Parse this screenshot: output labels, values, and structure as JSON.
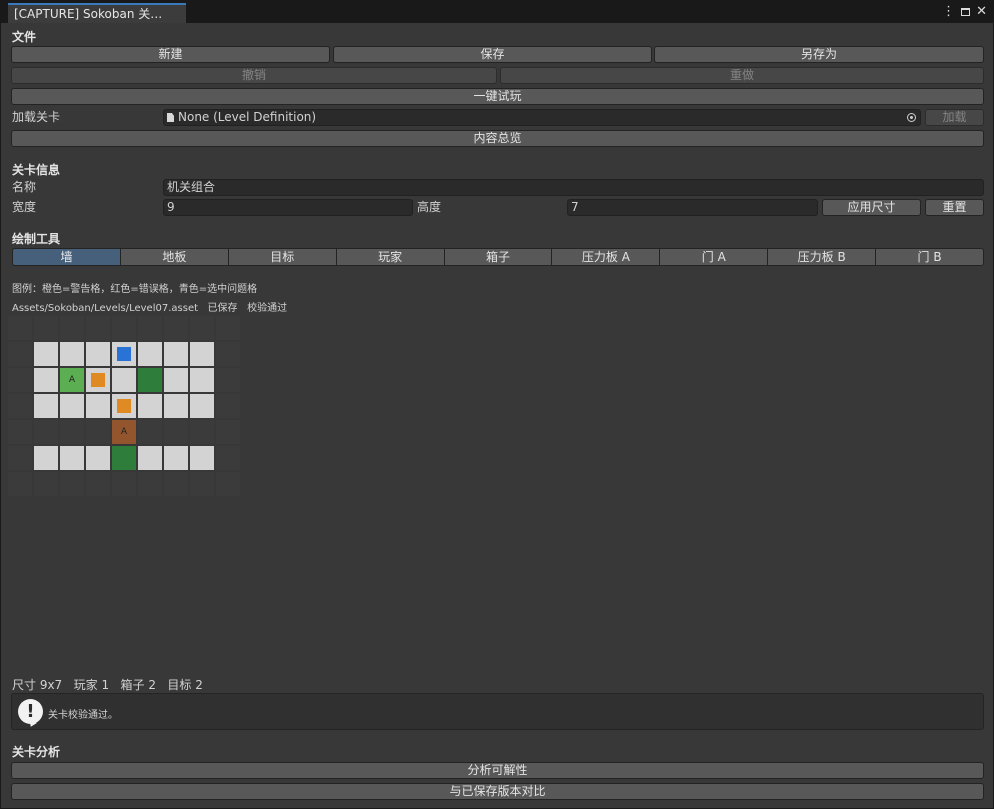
{
  "window": {
    "tab_title": "[CAPTURE] Sokoban 关…",
    "menu_glyph": "⋮",
    "close_glyph": "✕"
  },
  "file": {
    "section": "文件",
    "new": "新建",
    "save": "保存",
    "save_as": "另存为",
    "undo": "撤销",
    "redo": "重做",
    "play": "一键试玩",
    "load_label": "加载关卡",
    "load_value": "None (Level Definition)",
    "load_button": "加载",
    "overview": "内容总览"
  },
  "info": {
    "section": "关卡信息",
    "name_label": "名称",
    "name_value": "机关组合",
    "width_label": "宽度",
    "width_value": "9",
    "height_label": "高度",
    "height_value": "7",
    "apply_size": "应用尺寸",
    "reset": "重置"
  },
  "tools": {
    "section": "绘制工具",
    "items": [
      "墙",
      "地板",
      "目标",
      "玩家",
      "箱子",
      "压力板 A",
      "门 A",
      "压力板 B",
      "门 B"
    ],
    "selected_index": 0
  },
  "legend": "图例：橙色=警告格，红色=错误格，青色=选中问题格",
  "asset_status": "Assets/Sokoban/Levels/Level07.asset   已保存   校验通过",
  "grid": {
    "cols": 9,
    "rows": 7,
    "colors": {
      "wall": "#3b3b3b",
      "floor": "#d3d3d3",
      "plate": "#5cae52",
      "door": "#2f7d3b",
      "door_open": "#93552e",
      "player": "#2a73d6",
      "box": "#e08a23"
    },
    "cells": [
      [
        "wall",
        "wall",
        "wall",
        "wall",
        "wall",
        "wall",
        "wall",
        "wall",
        "wall"
      ],
      [
        "wall",
        "floor",
        "floor",
        "floor",
        "floor",
        "floor",
        "floor",
        "floor",
        "wall"
      ],
      [
        "wall",
        "floor",
        "plate",
        "floor",
        "floor",
        "door",
        "floor",
        "floor",
        "wall"
      ],
      [
        "wall",
        "floor",
        "floor",
        "floor",
        "floor",
        "floor",
        "floor",
        "floor",
        "wall"
      ],
      [
        "wall",
        "wall",
        "wall",
        "wall",
        "door_open",
        "wall",
        "wall",
        "wall",
        "wall"
      ],
      [
        "wall",
        "floor",
        "floor",
        "floor",
        "door",
        "floor",
        "floor",
        "floor",
        "wall"
      ],
      [
        "wall",
        "wall",
        "wall",
        "wall",
        "wall",
        "wall",
        "wall",
        "wall",
        "wall"
      ]
    ],
    "objects": [
      {
        "row": 1,
        "col": 4,
        "type": "player"
      },
      {
        "row": 2,
        "col": 3,
        "type": "box"
      },
      {
        "row": 3,
        "col": 4,
        "type": "box"
      }
    ],
    "labels": [
      {
        "row": 2,
        "col": 2,
        "text": "A"
      },
      {
        "row": 4,
        "col": 4,
        "text": "A"
      }
    ]
  },
  "stats": "尺寸 9x7   玩家 1   箱子 2   目标 2",
  "validation_message": "关卡校验通过。",
  "analysis": {
    "section": "关卡分析",
    "solvability": "分析可解性",
    "compare": "与已保存版本对比"
  }
}
